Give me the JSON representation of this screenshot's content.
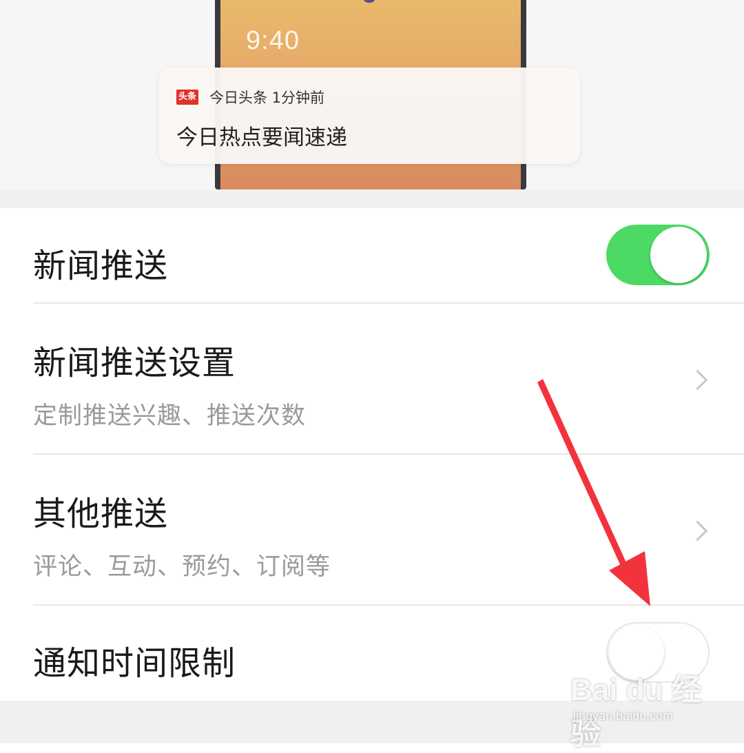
{
  "preview": {
    "time": "9:40",
    "notification": {
      "app_logo": "头条",
      "app_meta": "今日头条 1分钟前",
      "message": "今日热点要闻速递"
    }
  },
  "settings": {
    "news_push": {
      "title": "新闻推送",
      "toggle_on": true
    },
    "news_push_settings": {
      "title": "新闻推送设置",
      "subtitle": "定制推送兴趣、推送次数"
    },
    "other_push": {
      "title": "其他推送",
      "subtitle": "评论、互动、预约、订阅等"
    },
    "notify_time_limit": {
      "title": "通知时间限制",
      "toggle_on": false
    }
  },
  "colors": {
    "toggle_on": "#4cd964",
    "annotation_arrow": "#f2333d",
    "logo_red": "#e0302a"
  },
  "watermark": {
    "brand": "Bai du 经验",
    "url": "jingyan.baidu.com"
  }
}
